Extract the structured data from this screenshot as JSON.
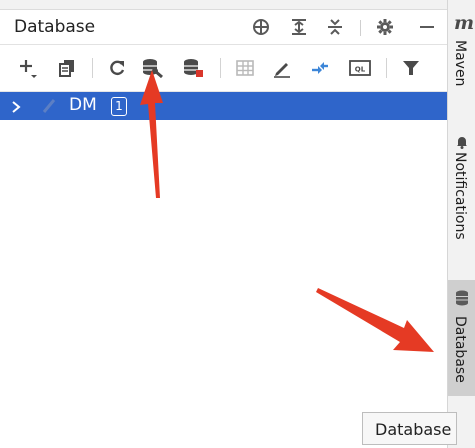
{
  "panel": {
    "title": "Database",
    "header_icons": [
      "crosshair-icon",
      "expand-all-icon",
      "collapse-all-icon",
      "gear-icon",
      "minimize-icon"
    ],
    "toolbar_icons": [
      "add-icon",
      "copy-icon",
      "refresh-icon",
      "db-properties-icon",
      "stop-db-icon",
      "table-icon",
      "edit-icon",
      "jump-icon",
      "sql-console-icon",
      "filter-icon"
    ]
  },
  "tree": {
    "items": [
      {
        "label": "DM",
        "badge": "1",
        "selected": true
      }
    ]
  },
  "sidebar": {
    "maven_logo": "m",
    "tabs": [
      {
        "label": "Maven"
      },
      {
        "label": "Notifications"
      },
      {
        "label": "Database",
        "active": true
      }
    ]
  },
  "tooltip": {
    "text": "Database"
  },
  "colors": {
    "selection": "#2f65ca",
    "icon_gray": "#5a5a5a",
    "icon_blue": "#3d86d8",
    "icon_red": "#d9362b",
    "arrow_red": "#e53a24"
  }
}
